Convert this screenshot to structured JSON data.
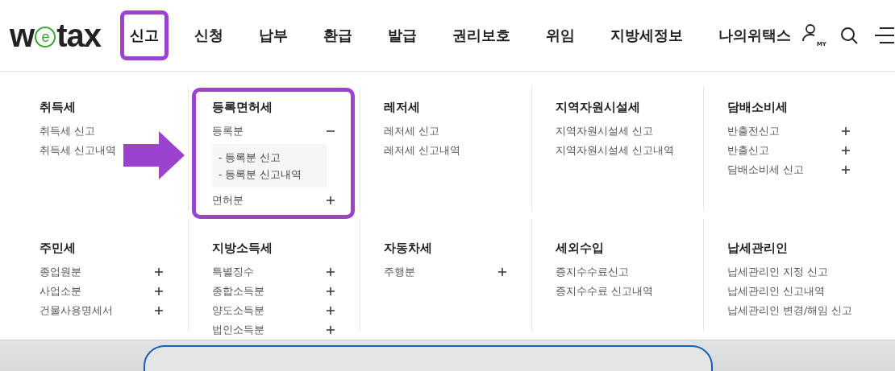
{
  "logo": {
    "before": "w",
    "circled": "e",
    "after": "tax"
  },
  "nav": [
    {
      "label": "신고",
      "selected": true,
      "highlighted": true
    },
    {
      "label": "신청",
      "selected": false,
      "highlighted": false
    },
    {
      "label": "납부",
      "selected": false,
      "highlighted": false
    },
    {
      "label": "환급",
      "selected": false,
      "highlighted": false
    },
    {
      "label": "발급",
      "selected": false,
      "highlighted": false
    },
    {
      "label": "권리보호",
      "selected": false,
      "highlighted": false
    },
    {
      "label": "위임",
      "selected": false,
      "highlighted": false
    },
    {
      "label": "지방세정보",
      "selected": false,
      "highlighted": false
    },
    {
      "label": "나의위택스",
      "selected": false,
      "highlighted": false
    }
  ],
  "my_badge": "MY",
  "menu_columns": [
    {
      "title": "취득세",
      "highlighted": false,
      "items": [
        {
          "label": "취득세 신고",
          "kind": "link"
        },
        {
          "label": "취득세 신고내역",
          "kind": "link"
        }
      ]
    },
    {
      "title": "등록면허세",
      "highlighted": true,
      "items": [
        {
          "label": "등록분",
          "kind": "group",
          "expanded": true,
          "children": [
            "- 등록분 신고",
            "- 등록분 신고내역"
          ]
        },
        {
          "label": "면허분",
          "kind": "group",
          "expanded": false
        }
      ]
    },
    {
      "title": "레저세",
      "highlighted": false,
      "items": [
        {
          "label": "레저세 신고",
          "kind": "link"
        },
        {
          "label": "레저세 신고내역",
          "kind": "link"
        }
      ]
    },
    {
      "title": "지역자원시설세",
      "highlighted": false,
      "items": [
        {
          "label": "지역자원시설세 신고",
          "kind": "link"
        },
        {
          "label": "지역자원시설세 신고내역",
          "kind": "link"
        }
      ]
    },
    {
      "title": "담배소비세",
      "highlighted": false,
      "items": [
        {
          "label": "반출전신고",
          "kind": "group",
          "expanded": false
        },
        {
          "label": "반출신고",
          "kind": "group",
          "expanded": false
        },
        {
          "label": "담배소비세 신고",
          "kind": "group",
          "expanded": false
        }
      ]
    },
    {
      "title": "주민세",
      "highlighted": false,
      "items": [
        {
          "label": "종업원분",
          "kind": "group",
          "expanded": false
        },
        {
          "label": "사업소분",
          "kind": "group",
          "expanded": false
        },
        {
          "label": "건물사용명세서",
          "kind": "group",
          "expanded": false
        }
      ]
    },
    {
      "title": "지방소득세",
      "highlighted": false,
      "items": [
        {
          "label": "특별징수",
          "kind": "group",
          "expanded": false
        },
        {
          "label": "종합소득분",
          "kind": "group",
          "expanded": false
        },
        {
          "label": "양도소득분",
          "kind": "group",
          "expanded": false
        },
        {
          "label": "법인소득분",
          "kind": "group",
          "expanded": false
        }
      ]
    },
    {
      "title": "자동차세",
      "highlighted": false,
      "items": [
        {
          "label": "주행분",
          "kind": "group",
          "expanded": false
        }
      ]
    },
    {
      "title": "세외수입",
      "highlighted": false,
      "items": [
        {
          "label": "증지수수료신고",
          "kind": "link"
        },
        {
          "label": "증지수수료 신고내역",
          "kind": "link"
        }
      ]
    },
    {
      "title": "납세관리인",
      "highlighted": false,
      "items": [
        {
          "label": "납세관리인 지정 신고",
          "kind": "link"
        },
        {
          "label": "납세관리인 신고내역",
          "kind": "link"
        },
        {
          "label": "납세관리인 변경/해임 신고",
          "kind": "link"
        }
      ]
    }
  ]
}
